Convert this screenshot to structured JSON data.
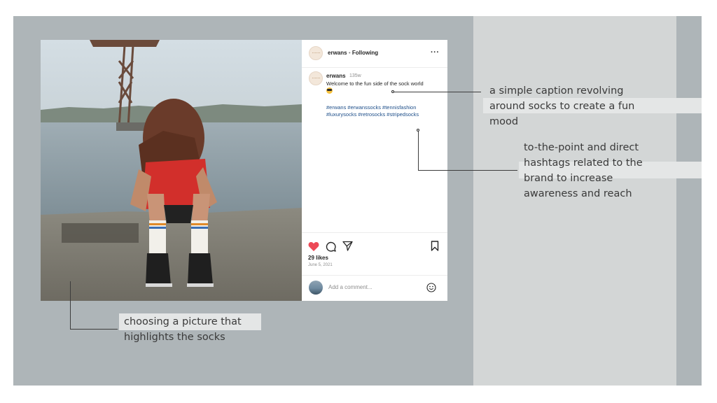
{
  "post": {
    "username": "erwans",
    "separator": "•",
    "following": "Following",
    "more": "···",
    "caption_user": "erwans",
    "caption_time": "135w",
    "caption_text": "Welcome to the fun side of the sock world",
    "hashtags_line1": "#erwans #erwanssocks #tennisfashion",
    "hashtags_line2": "#luxurysocks #retrosocks #stripedsocks",
    "likes": "29 likes",
    "date": "June 5, 2021",
    "comment_placeholder": "Add a comment..."
  },
  "annotations": {
    "caption_line1": "a simple caption revolving",
    "caption_line2": "around socks to create a fun",
    "caption_line3": "mood",
    "hashtags_line1": "to-the-point and direct",
    "hashtags_line2": "hashtags related to the",
    "hashtags_line3": "brand to increase",
    "hashtags_line4": "awareness and reach",
    "picture_line1": "choosing a picture that",
    "picture_line2": "highlights the socks"
  },
  "colors": {
    "panel_gray": "#aeb5b8",
    "panel_light": "#d3d6d6",
    "heart": "#ed4956",
    "hashtag": "#1d4e89"
  },
  "icons": [
    "more-icon",
    "heart-icon",
    "comment-icon",
    "share-icon",
    "bookmark-icon",
    "smile-icon"
  ]
}
